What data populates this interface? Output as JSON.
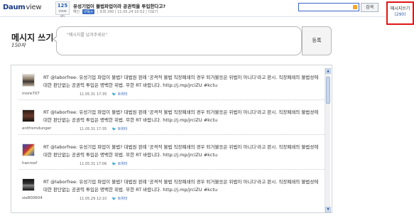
{
  "header": {
    "logo_daum": "Daum",
    "logo_view": "view",
    "view_count": "125",
    "view_label": "view on",
    "headline": "유성기업이 불법파업이라 공권력을 투입한다고?",
    "meta_prefix": "해인",
    "meta_badge": "구독+",
    "meta_rest": "| 조회 290 | 11.05.24 10:52 | 더보기",
    "search_button": "검색",
    "message_box_title": "메시지쓰기",
    "message_box_count": "(290)"
  },
  "compose": {
    "title": "메시지 쓰기",
    "limit": "150자",
    "placeholder": "\"메시지를 남겨주세요\"",
    "submit_label": "등록"
  },
  "feed": {
    "items": [
      {
        "author": "more707",
        "date": "11.05.31 17:35",
        "source": "트위터",
        "text": "RT @laborfree: 유성기업 파업이 불법? 대법원 판례 '공격적 불법 직장폐쇄의 경우 퇴거불응은 위법이 아니다'라고 판시. 직장폐쇄의 불법성에 대한 판단없는 공권력 투입은 명백한 위법. 무한 RT 바랍니다. http://j.mp/jrciZU #kctu"
      },
      {
        "author": "entfremdunger",
        "date": "11.05.31 17:35",
        "source": "트위터",
        "text": "RT @laborfree: 유성기업 파업이 불법? 대법원 판례 '공격적 불법 직장폐쇄의 경우 퇴거불응은 위법이 아니다'라고 판시. 직장폐쇄의 불법성에 대한 판단없는 공권력 투입은 명백한 위법. 무한 RT 바랍니다. http://j.mp/jrciZU #kctu"
      },
      {
        "author": "hanroof",
        "date": "11.05.31 17:06",
        "source": "트위터",
        "text": "RT @laborfree: 유성기업 파업이 불법? 대법원 판례 '공격적 불법 직장폐쇄의 경우 퇴거불응은 위법이 아니다'라고 판시. 직장폐쇄의 불법성에 대한 판단없는 공권력 투입은 명백한 위법. 무한 RT 바랍니다. http://j.mp/jrciZU #kctu"
      },
      {
        "author": "sie800604",
        "date": "11.05.29 12:10",
        "source": "트위터",
        "text": "RT @laborfree: 유성기업 파업이 불법? 대법원 판례 '공격적 불법 직장폐쇄의 경우 퇴거불응은 위법이 아니다'라고 판시. 직장폐쇄의 불법성에 대한 판단없는 공권력 투입은 명백한 위법. 무한 RT 바랍니다. http://j.mp/jrciZU #kctu"
      }
    ]
  },
  "colors": {
    "brand_blue": "#1a3a86",
    "accent_red": "#e01515",
    "link_blue": "#2a5db0",
    "twitter_blue": "#3aa3e3"
  },
  "icons": {
    "search": "search-icon",
    "scroll_up": "chevron-up-icon",
    "scroll_down": "chevron-down-icon",
    "twitter": "twitter-bird-icon"
  }
}
